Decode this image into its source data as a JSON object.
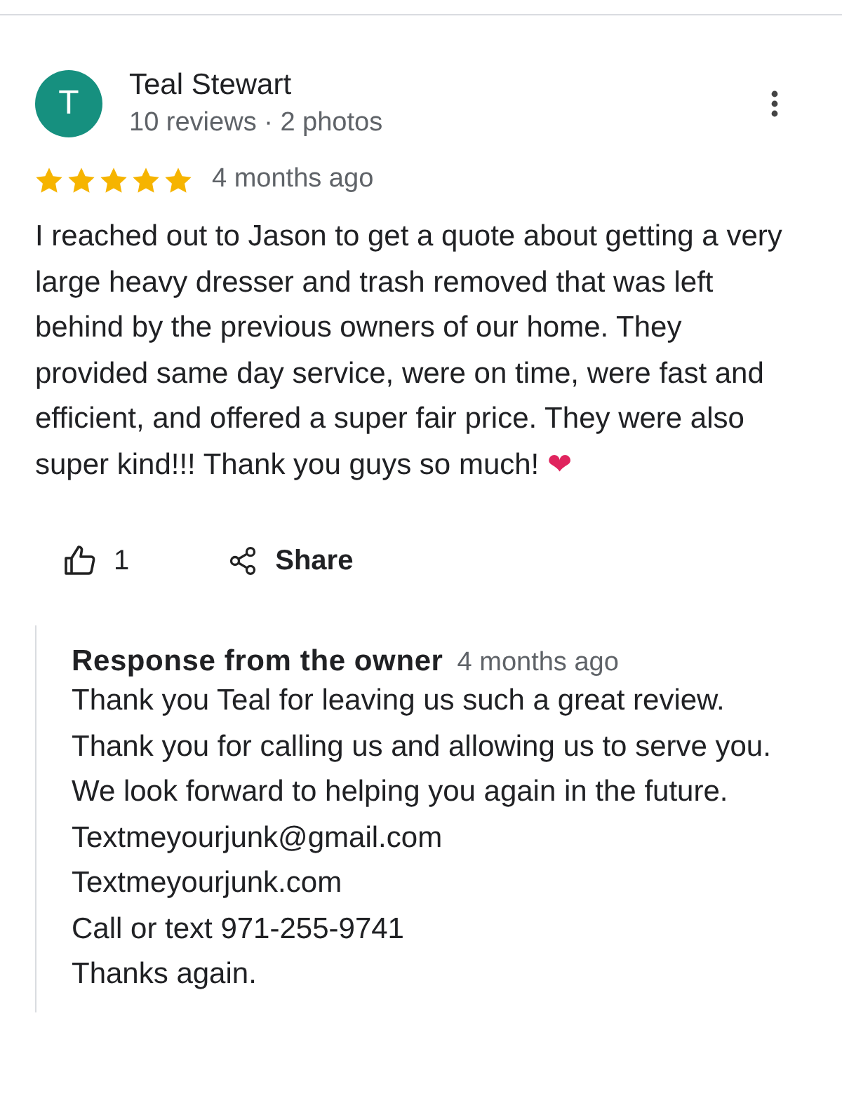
{
  "reviewer": {
    "initial": "T",
    "name": "Teal Stewart",
    "meta": "10 reviews · 2 photos"
  },
  "review": {
    "stars": 5,
    "time": "4 months ago",
    "text": "I reached out to Jason to get a quote about getting a very large heavy dresser and trash removed that was left behind by the previous owners of our home. They provided same day service, were on time, were fast and efficient, and offered a super fair price. They were also super kind!!! Thank you guys so much!",
    "emoji": "❤"
  },
  "actions": {
    "likes": "1",
    "share": "Share"
  },
  "response": {
    "title": "Response from the owner",
    "time": "4 months ago",
    "lines": [
      "Thank you Teal for leaving us such a great review. Thank you for calling us and allowing us to serve you. We look forward to helping you again in the future.",
      "Textmeyourjunk@gmail.com",
      "Textmeyourjunk.com",
      "Call or text 971-255-9741",
      "Thanks again."
    ]
  }
}
